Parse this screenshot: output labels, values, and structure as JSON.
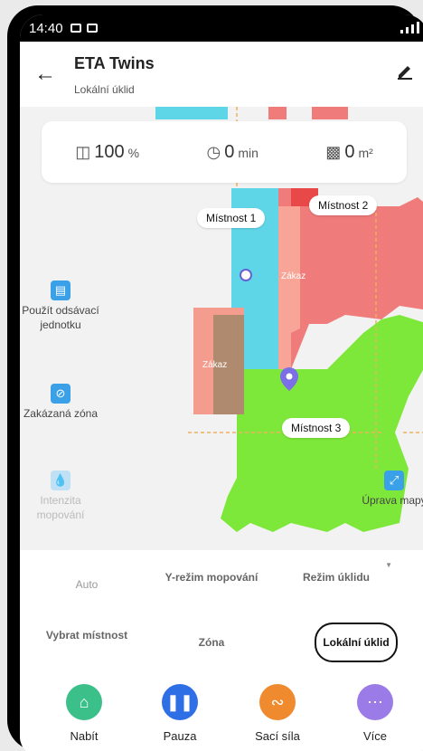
{
  "status": {
    "time": "14:40"
  },
  "header": {
    "title": "ETA Twins",
    "subtitle": "Lokální úklid"
  },
  "stats": {
    "battery": {
      "value": "100",
      "unit": "%"
    },
    "time": {
      "value": "0",
      "unit": "min"
    },
    "area": {
      "value": "0",
      "unit": "m²"
    }
  },
  "map": {
    "rooms": [
      "Místnost 1",
      "Místnost 2",
      "Místnost 3"
    ],
    "zone_label": "Zákaz"
  },
  "side": {
    "left": [
      {
        "label": "Použít odsávací jednotku"
      },
      {
        "label": "Zakázaná zóna"
      },
      {
        "label": "Intenzita mopování"
      }
    ],
    "right": {
      "label": "Úprava mapy"
    }
  },
  "modes": {
    "auto": "Auto",
    "y_mop": "Y-režim mopování",
    "cleaning": "Režim úklidu",
    "select_room": "Vybrat místnost",
    "zone": "Zóna",
    "local": "Lokální úklid"
  },
  "actions": {
    "charge": "Nabít",
    "pause": "Pauza",
    "suction": "Sací síla",
    "more": "Více"
  },
  "colors": {
    "room1": "#5fd6e8",
    "room2": "#f07b7b",
    "room3": "#7ee83a",
    "forbidden": "#ff3b3b",
    "charge": "#3cc08a",
    "pause": "#2f6fe6",
    "suction": "#f08a2e",
    "more": "#9a7be8"
  }
}
